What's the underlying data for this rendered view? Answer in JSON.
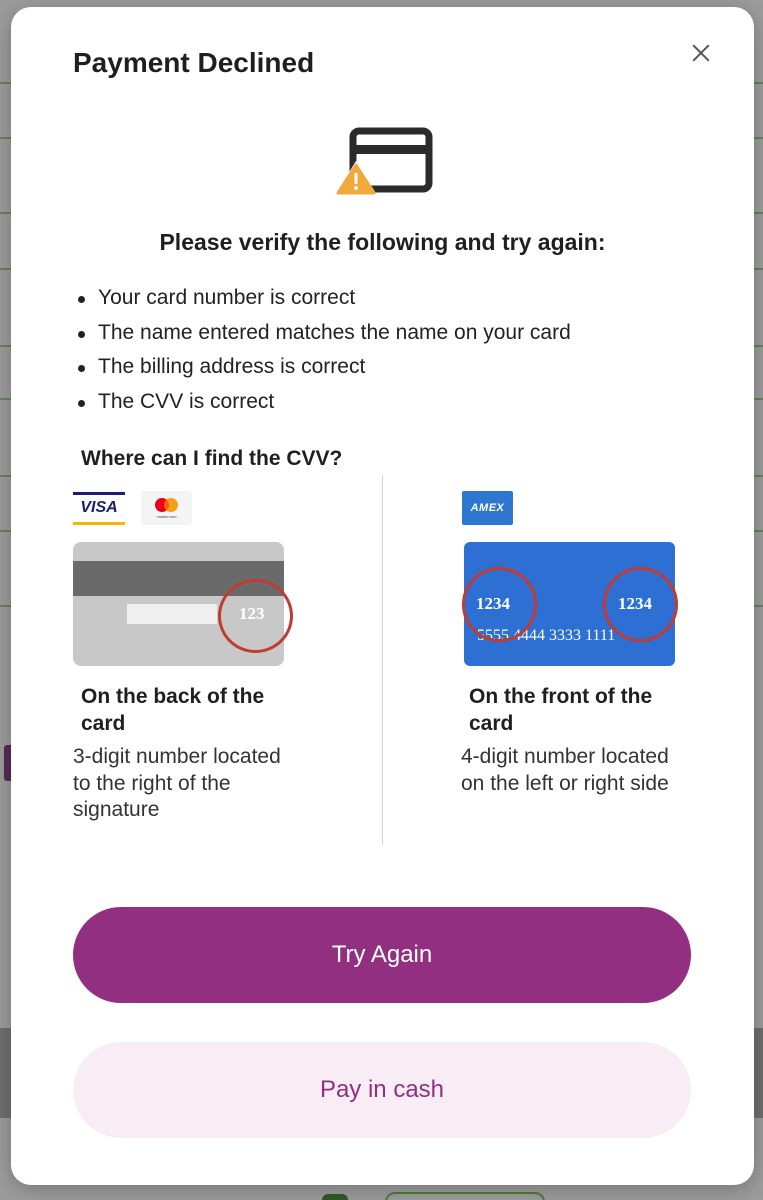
{
  "modal": {
    "title": "Payment Declined",
    "headline": "Please verify the following and try again:",
    "checklist": [
      "Your card number is correct",
      "The name entered matches the name on your card",
      "The billing address is correct",
      "The CVV is correct"
    ],
    "cvv_question": "Where can I find the CVV?",
    "back_card": {
      "brands": [
        "VISA",
        "mastercard"
      ],
      "cvv_example": "123",
      "title": "On the back of the card",
      "description": "3-digit number located to the right of the signature"
    },
    "front_card": {
      "brand": "AMEX",
      "cvv_example_left": "1234",
      "cvv_example_right": "1234",
      "card_number": "5555 4444 3333 1111",
      "title": "On the front of the card",
      "description": "4-digit number located on the left or right side"
    },
    "primary_button": "Try Again",
    "secondary_button": "Pay in cash"
  },
  "colors": {
    "accent": "#922f81",
    "secondary_bg": "#f8edf5",
    "warning": "#f2a93b",
    "ring": "#c03b32",
    "amex_blue": "#2e6fd3"
  },
  "icons": [
    "close-icon",
    "card-warning-icon"
  ]
}
